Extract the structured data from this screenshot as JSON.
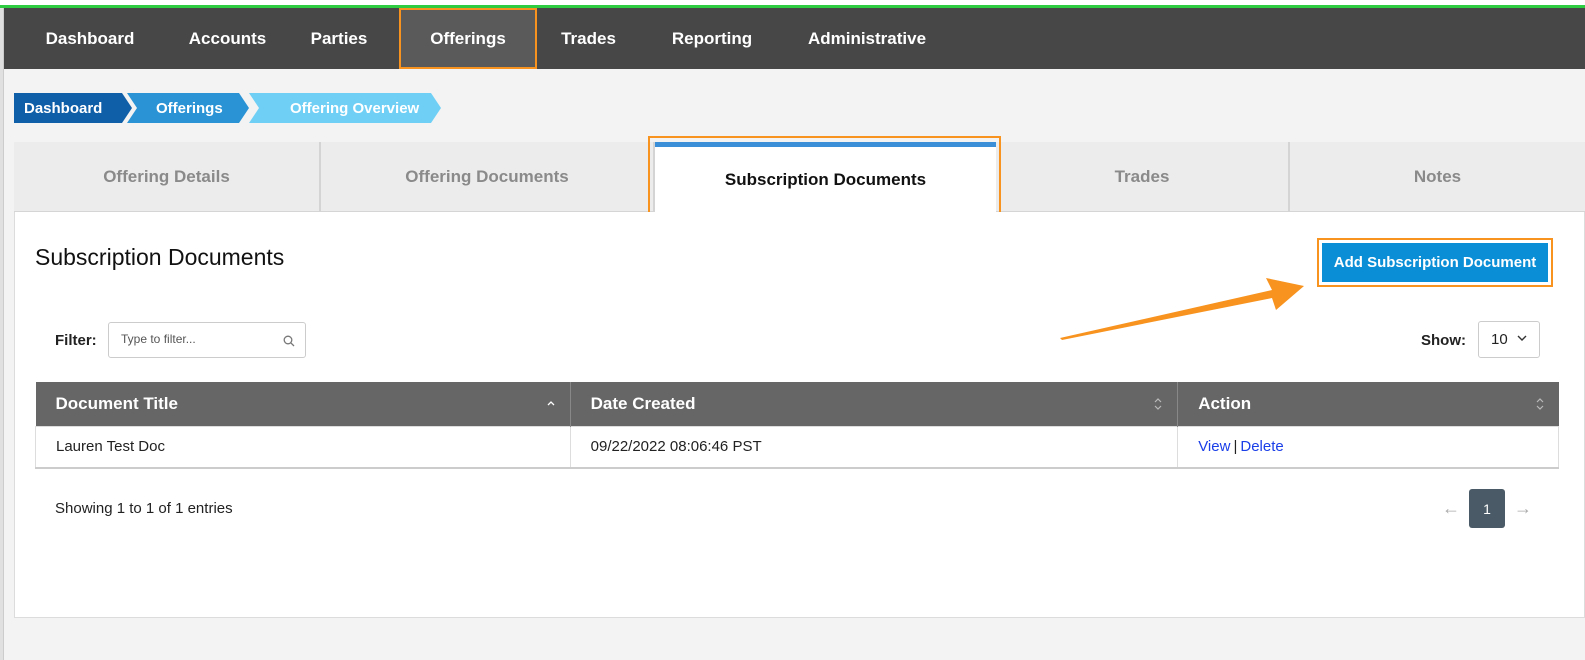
{
  "nav": {
    "items": [
      {
        "label": "Dashboard"
      },
      {
        "label": "Accounts"
      },
      {
        "label": "Parties"
      },
      {
        "label": "Offerings"
      },
      {
        "label": "Trades"
      },
      {
        "label": "Reporting"
      },
      {
        "label": "Administrative"
      }
    ],
    "active": "Offerings"
  },
  "breadcrumb": [
    {
      "label": "Dashboard",
      "color": "#0e5ea8"
    },
    {
      "label": "Offerings",
      "color": "#2a93d5"
    },
    {
      "label": "Offering Overview",
      "color": "#6fcff5"
    }
  ],
  "tabs": [
    {
      "label": "Offering Details"
    },
    {
      "label": "Offering Documents"
    },
    {
      "label": "Subscription Documents"
    },
    {
      "label": "Trades"
    },
    {
      "label": "Notes"
    }
  ],
  "active_tab": "Subscription Documents",
  "panel": {
    "title": "Subscription Documents",
    "add_button": "Add Subscription Document",
    "filter_label": "Filter:",
    "filter_placeholder": "Type to filter...",
    "show_label": "Show:",
    "show_value": "10"
  },
  "table": {
    "headers": [
      "Document Title",
      "Date Created",
      "Action"
    ],
    "rows": [
      {
        "title": "Lauren Test Doc",
        "date": "09/22/2022 08:06:46 PST",
        "view": "View",
        "delete": "Delete"
      }
    ]
  },
  "footer": {
    "showing": "Showing 1 to 1 of 1 entries",
    "prev": "←",
    "page": "1",
    "next": "→"
  },
  "colors": {
    "accent_orange": "#f7931e",
    "primary_blue": "#0a8fd6",
    "nav_bg": "#474747"
  }
}
